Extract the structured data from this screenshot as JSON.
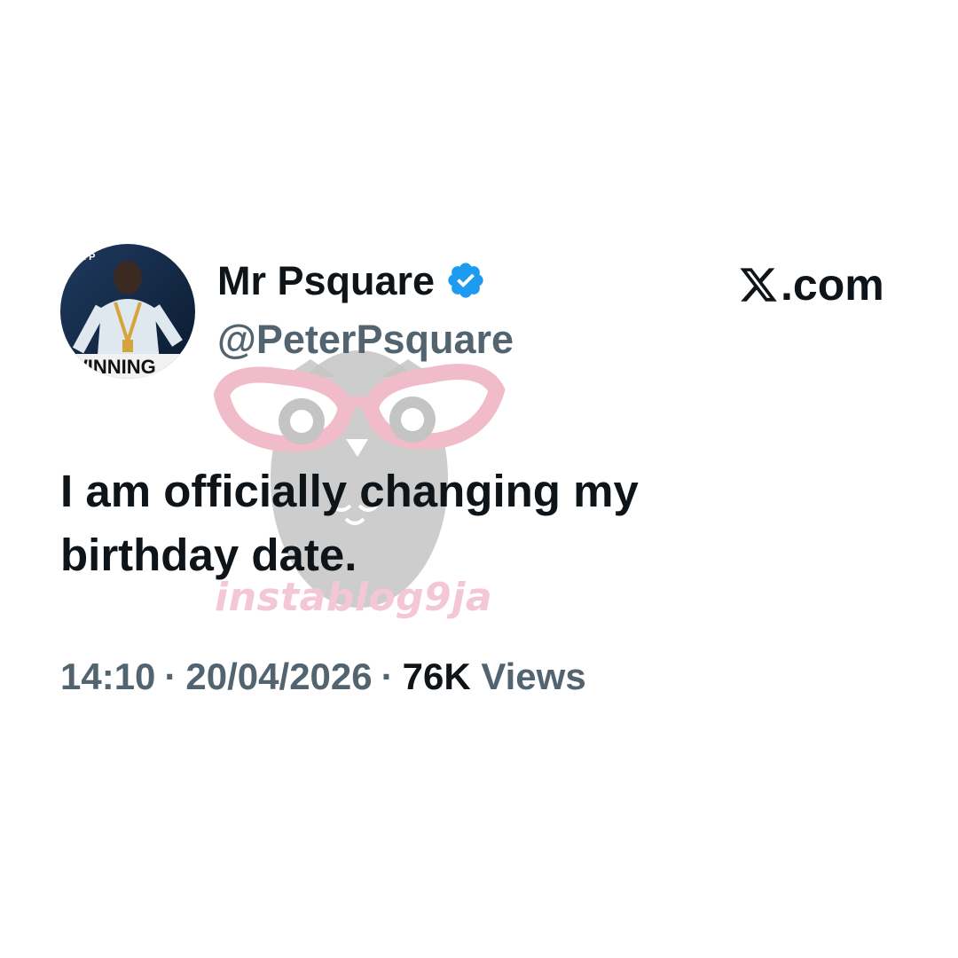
{
  "author": {
    "display_name": "Mr Psquare",
    "handle": "@PeterPsquare",
    "verified": true,
    "avatar_caption": "WINNING",
    "avatar_corner_text": "MR P"
  },
  "brand": {
    "text": ".com",
    "icon": "x-logo-icon"
  },
  "tweet": {
    "text": "I am officially changing my birthday date."
  },
  "meta": {
    "time": "14:10",
    "separator": "·",
    "date": "20/04/2026",
    "views_count": "76K",
    "views_label": "Views"
  },
  "watermark": {
    "text": "instablog9ja"
  },
  "colors": {
    "primary_text": "#0f1419",
    "secondary_text": "#536471",
    "verified_blue": "#1d9bf0",
    "watermark_pink": "#f3c7d8",
    "watermark_gray": "#bcbcbc"
  }
}
